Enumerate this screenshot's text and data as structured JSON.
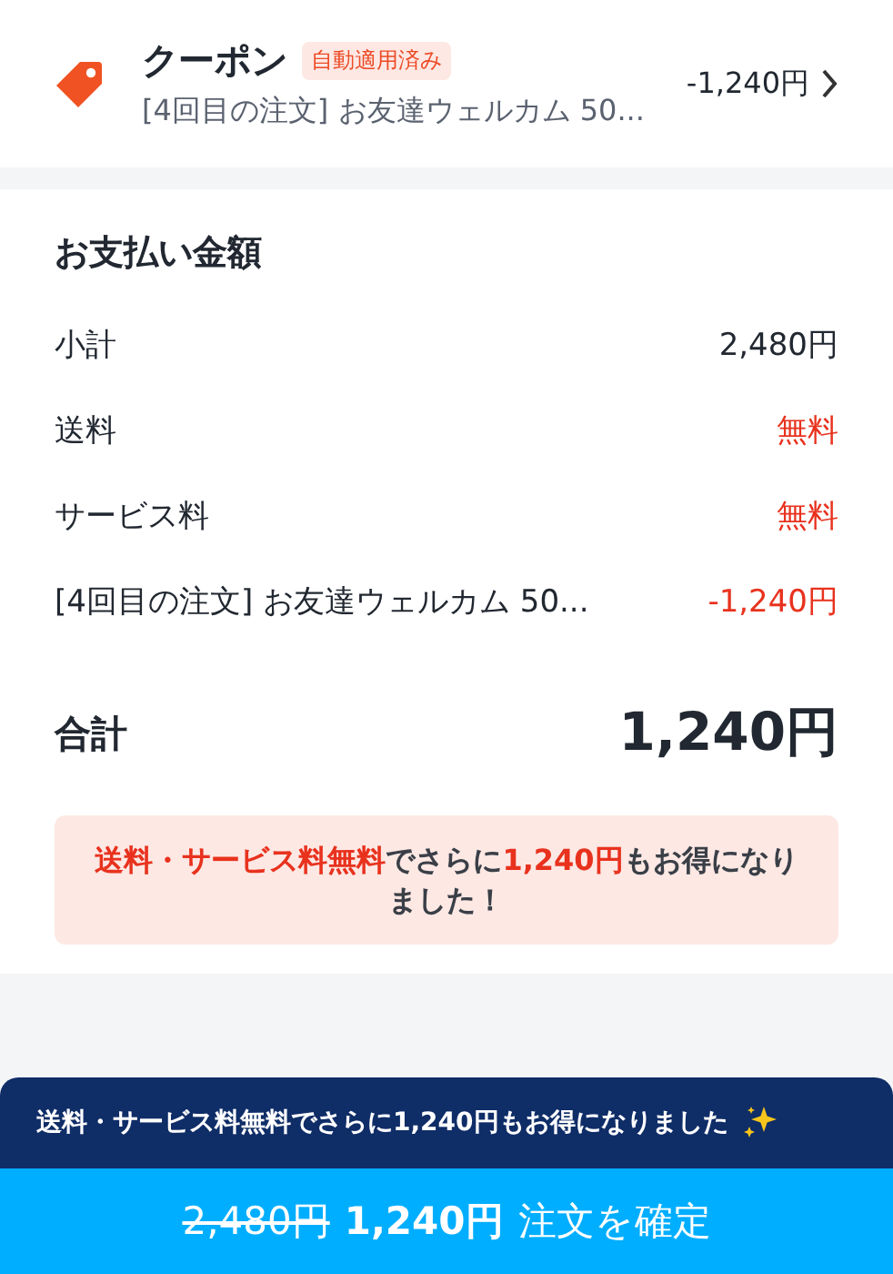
{
  "coupon": {
    "title": "クーポン",
    "badge": "自動適用済み",
    "description": "[4回目の注文] お友達ウェルカム 50...",
    "amount": "-1,240円"
  },
  "payment": {
    "title": "お支払い金額",
    "rows": [
      {
        "label": "小計",
        "value": "2,480円",
        "kind": "plain"
      },
      {
        "label": "送料",
        "value": "無料",
        "kind": "discount"
      },
      {
        "label": "サービス料",
        "value": "無料",
        "kind": "discount"
      },
      {
        "label": "[4回目の注文] お友達ウェルカム 50...",
        "value": "-1,240円",
        "kind": "discount"
      }
    ],
    "total_label": "合計",
    "total_value": "1,240円",
    "savings_note": "**送料・サービス料無料**でさらに**1,240円**もお得になりました！"
  },
  "banner": {
    "text": "送料・サービス料無料でさらに**1,240円**もお得になりました"
  },
  "order_button": {
    "original_price": "2,480円",
    "price": "1,240円",
    "label": "注文を確定"
  }
}
